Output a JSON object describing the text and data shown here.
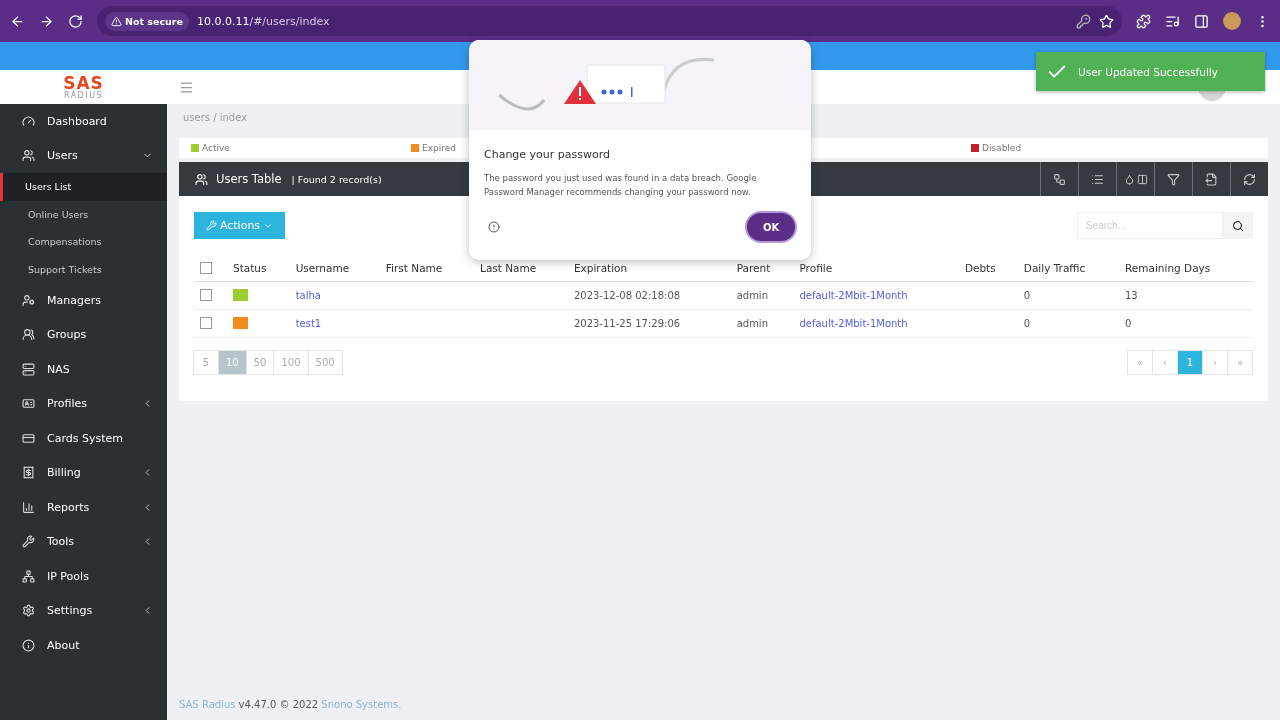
{
  "browser": {
    "security": "Not secure",
    "url_host": "10.0.0.11",
    "url_path": "/#/users/index"
  },
  "logo": {
    "title": "SAS",
    "subtitle": "RADIUS"
  },
  "sidebar": {
    "items": [
      {
        "label": "Dashboard",
        "kind": "link",
        "selected": false
      },
      {
        "label": "Users",
        "kind": "menu",
        "expanded": true,
        "selected": false,
        "children": [
          {
            "label": "Users List",
            "selected": true
          },
          {
            "label": "Online Users",
            "selected": false
          },
          {
            "label": "Compensations",
            "selected": false
          },
          {
            "label": "Support Tickets",
            "selected": false
          }
        ]
      },
      {
        "label": "Managers",
        "kind": "link",
        "selected": false
      },
      {
        "label": "Groups",
        "kind": "link",
        "selected": false
      },
      {
        "label": "NAS",
        "kind": "link",
        "selected": false
      },
      {
        "label": "Profiles",
        "kind": "menu",
        "expanded": false,
        "selected": false
      },
      {
        "label": "Cards System",
        "kind": "link",
        "selected": false
      },
      {
        "label": "Billing",
        "kind": "menu",
        "expanded": false,
        "selected": false
      },
      {
        "label": "Reports",
        "kind": "menu",
        "expanded": false,
        "selected": false
      },
      {
        "label": "Tools",
        "kind": "menu",
        "expanded": false,
        "selected": false
      },
      {
        "label": "IP Pools",
        "kind": "link",
        "selected": false
      },
      {
        "label": "Settings",
        "kind": "menu",
        "expanded": false,
        "selected": false
      },
      {
        "label": "About",
        "kind": "link",
        "selected": false
      }
    ]
  },
  "breadcrumb": "users / index",
  "legend": [
    {
      "label": "Active",
      "color": "#9acd32"
    },
    {
      "label": "Expired",
      "color": "#f28c1e"
    },
    {
      "label": "Disabled",
      "color": "#c0232f"
    }
  ],
  "table_bar": {
    "title": "Users Table",
    "count": "| Found 2  record(s)"
  },
  "actions_button": "Actions",
  "search": {
    "placeholder": "Search..."
  },
  "table": {
    "select_all_checked": false,
    "columns": [
      "Status",
      "Username",
      "First Name",
      "Last Name",
      "Expiration",
      "Parent",
      "Profile",
      "Debts",
      "Daily Traffic",
      "Remaining Days"
    ],
    "rows": [
      {
        "checked": false,
        "color": "#9acd32",
        "username": "talha",
        "expiration": "2023-12-08 02:18:08",
        "parent": "admin",
        "profile": "default-2Mbit-1Month",
        "daily_traffic": "0",
        "remaining_days": "13"
      },
      {
        "checked": false,
        "color": "#f28c1e",
        "username": "test1",
        "expiration": "2023-11-25 17:29:06",
        "parent": "admin",
        "profile": "default-2Mbit-1Month",
        "daily_traffic": "0",
        "remaining_days": "0"
      }
    ]
  },
  "page_sizes": [
    {
      "label": "5",
      "selected": false
    },
    {
      "label": "10",
      "selected": true
    },
    {
      "label": "50",
      "selected": false
    },
    {
      "label": "100",
      "selected": false
    },
    {
      "label": "500",
      "selected": false
    }
  ],
  "pager": [
    {
      "label": "«",
      "selected": false
    },
    {
      "label": "‹",
      "selected": false
    },
    {
      "label": "1",
      "selected": true
    },
    {
      "label": "›",
      "selected": false
    },
    {
      "label": "»",
      "selected": false
    }
  ],
  "footer": {
    "product": "SAS Radius",
    "version": " v4.47.0 © 2022 ",
    "company": "Snono Systems."
  },
  "dialog": {
    "title": "Change your password",
    "body": "The password you just used was found in a data breach. Google Password Manager recommends changing your password now.",
    "ok": "OK"
  },
  "toast": {
    "message": "User Updated Successfully"
  }
}
